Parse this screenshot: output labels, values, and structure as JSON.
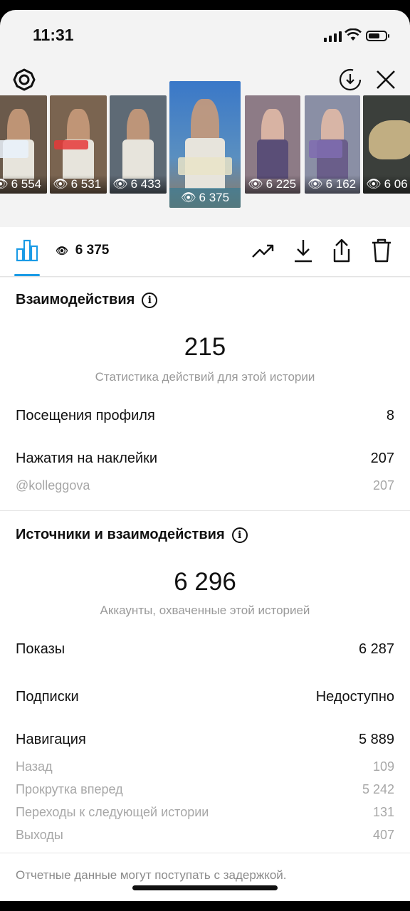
{
  "status": {
    "time": "11:31"
  },
  "thumbnails": [
    {
      "views": "6 554",
      "bg": "#6b5a4b"
    },
    {
      "views": "6 531",
      "bg": "#7a6450"
    },
    {
      "views": "6 433",
      "bg": "#5e6a75"
    },
    {
      "views": "6 375",
      "bg": "#4b7fb8",
      "selected": true
    },
    {
      "views": "6 225",
      "bg": "#8d7b86"
    },
    {
      "views": "6 162",
      "bg": "#8a8fa5"
    },
    {
      "views": "6 06",
      "bg": "#3b3f3b"
    }
  ],
  "tabbar": {
    "views": "6 375"
  },
  "interactions": {
    "title": "Взаимодействия",
    "total": "215",
    "subtitle": "Статистика действий для этой истории",
    "rows": [
      {
        "label": "Посещения профиля",
        "value": "8"
      },
      {
        "label": "Нажатия на наклейки",
        "value": "207"
      }
    ],
    "sub_rows": [
      {
        "label": "@kolleggova",
        "value": "207"
      }
    ]
  },
  "reach": {
    "title": "Источники и взаимодействия",
    "total": "6 296",
    "subtitle": "Аккаунты, охваченные этой историей",
    "impressions": {
      "label": "Показы",
      "value": "6 287"
    },
    "follows": {
      "label": "Подписки",
      "value": "Недоступно"
    },
    "navigation": {
      "label": "Навигация",
      "value": "5 889"
    },
    "nav_items": [
      {
        "label": "Назад",
        "value": "109"
      },
      {
        "label": "Прокрутка вперед",
        "value": "5 242"
      },
      {
        "label": "Переходы к следующей истории",
        "value": "131"
      },
      {
        "label": "Выходы",
        "value": "407"
      }
    ]
  },
  "footer": {
    "note": "Отчетные данные могут поступать с задержкой."
  },
  "colors": {
    "accent": "#1b9be6"
  }
}
